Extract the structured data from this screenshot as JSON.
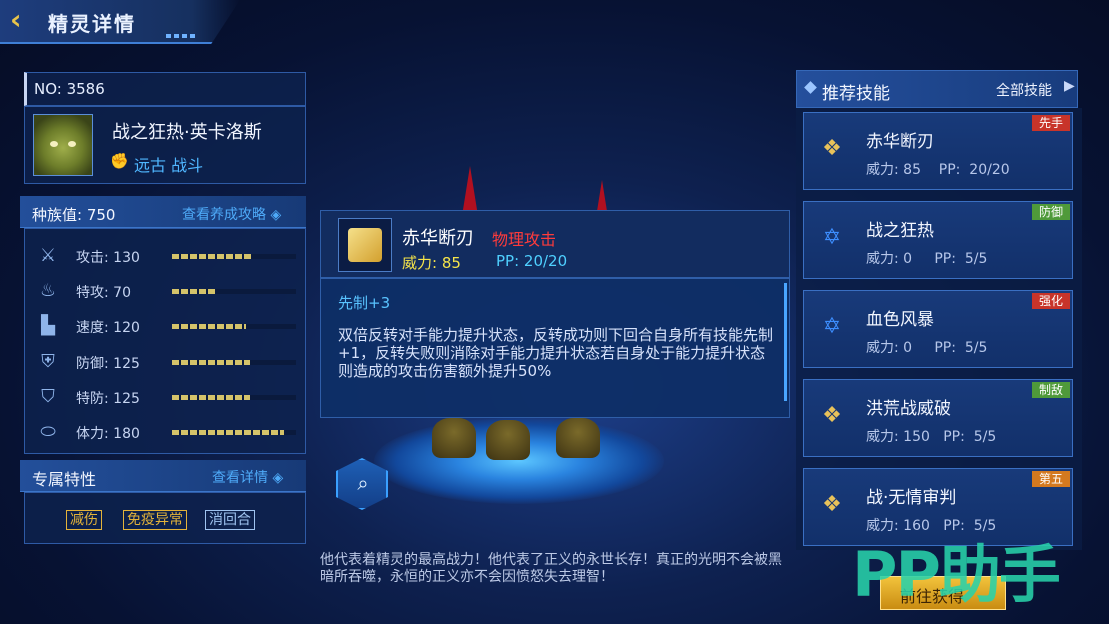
{
  "header": {
    "back_icon": "chevron-left-icon",
    "title": "精灵详情"
  },
  "spirit": {
    "no_label": "NO:  3586",
    "name": "战之狂热·英卡洛斯",
    "type_text": "远古 战斗",
    "race_label": "种族值:  750",
    "race_link": "查看养成攻略 ◈",
    "stats": [
      {
        "label": "攻击:  130",
        "icon": "sword-icon",
        "value": 130
      },
      {
        "label": "特攻:  70",
        "icon": "flame-icon",
        "value": 70
      },
      {
        "label": "速度:  120",
        "icon": "boot-icon",
        "value": 120
      },
      {
        "label": "防御:  125",
        "icon": "shield-icon",
        "value": 125
      },
      {
        "label": "特防:  125",
        "icon": "crest-shield-icon",
        "value": 125
      },
      {
        "label": "体力:  180",
        "icon": "capsule-icon",
        "value": 180
      }
    ],
    "stat_max": 200
  },
  "traits": {
    "title": "专属特性",
    "link": "查看详情 ◈",
    "tags": [
      {
        "text": "减伤",
        "color": "#e3b33a"
      },
      {
        "text": "免疫异常",
        "color": "#e3b33a"
      },
      {
        "text": "消回合",
        "color": "#9fc3f0"
      }
    ]
  },
  "tooltip": {
    "name": "赤华断刃",
    "category": "物理攻击",
    "power": "威力:  85",
    "pp": "PP:  20/20",
    "priority": "先制+3",
    "description": "双倍反转对手能力提升状态，反转成功则下回合自身所有技能先制+1，反转失败则消除对手能力提升状态若自身处于能力提升状态则造成的攻击伤害额外提升50%"
  },
  "bottom_text": "他代表着精灵的最高战力！他代表了正义的永世长存！真正的光明不会被黑暗所吞噬，永恒的正义亦不会因愤怒失去理智！",
  "recommend": {
    "title": "推荐技能",
    "all_link": "全部技能",
    "skills": [
      {
        "name": "赤华断刃",
        "stats": "威力: 85    PP:  20/20",
        "tag": "先手",
        "tag_color": "#c8342a",
        "icon": "golden-blade-icon"
      },
      {
        "name": "战之狂热",
        "stats": "威力: 0     PP:  5/5",
        "tag": "防御",
        "tag_color": "#4f9a3a",
        "icon": "blue-star-icon"
      },
      {
        "name": "血色风暴",
        "stats": "威力: 0     PP:  5/5",
        "tag": "强化",
        "tag_color": "#c8342a",
        "icon": "blue-star-icon"
      },
      {
        "name": "洪荒战威破",
        "stats": "威力: 150   PP:  5/5",
        "tag": "制敌",
        "tag_color": "#4f9a3a",
        "icon": "golden-blade-icon"
      },
      {
        "name": "战·无情审判",
        "stats": "威力: 160   PP:  5/5",
        "tag": "第五",
        "tag_color": "#d4791f",
        "icon": "golden-blade-icon"
      }
    ]
  },
  "goto_button": "前往获得",
  "watermark": "PP助手"
}
